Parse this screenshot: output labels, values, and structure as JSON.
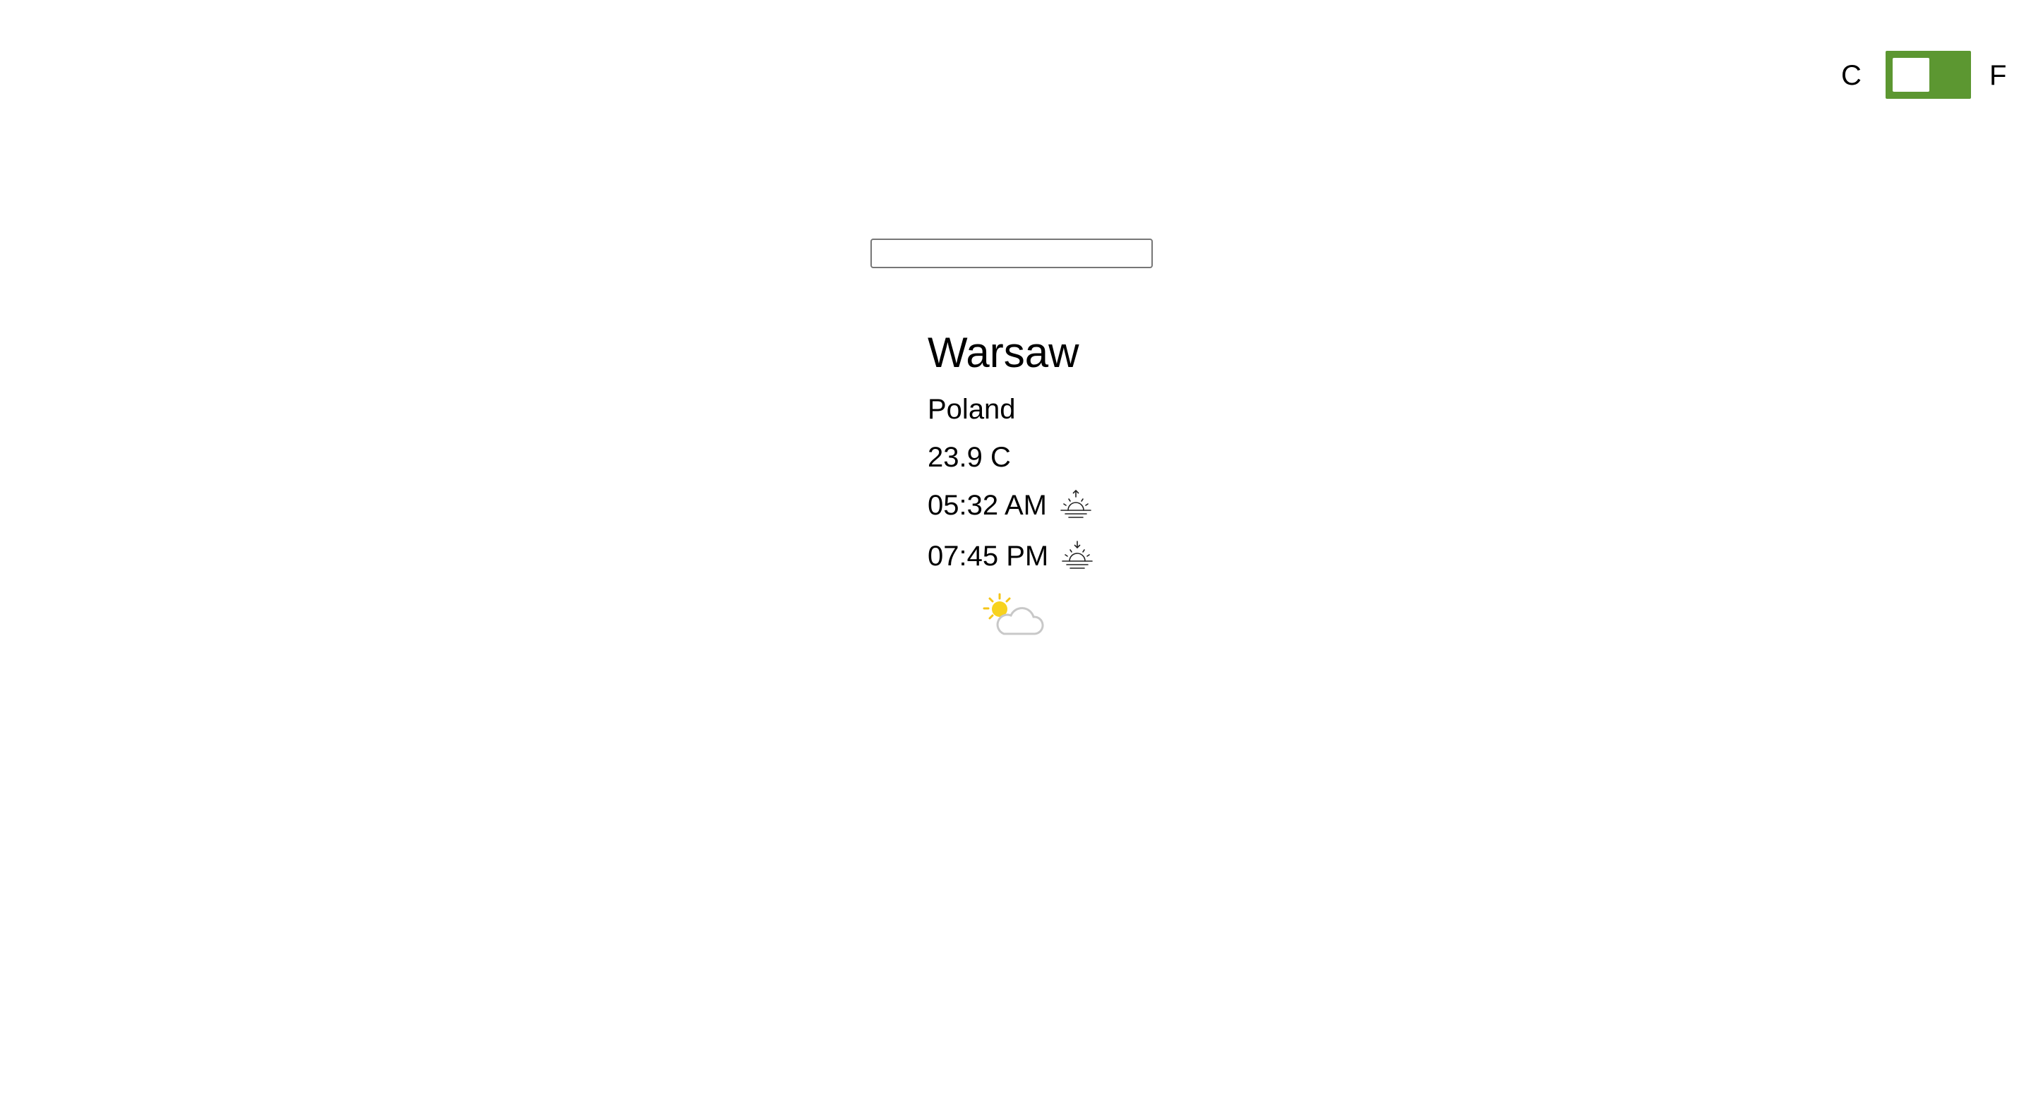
{
  "unit_toggle": {
    "left_label": "C",
    "right_label": "F"
  },
  "search": {
    "value": "",
    "placeholder": ""
  },
  "weather": {
    "city": "Warsaw",
    "country": "Poland",
    "temperature": "23.9 C",
    "sunrise": "05:32 AM",
    "sunset": "07:45 PM",
    "sunrise_icon": "sunrise-icon",
    "sunset_icon": "sunset-icon",
    "condition_icon": "partly-cloudy-icon"
  },
  "colors": {
    "toggle_background": "#5c9731",
    "toggle_knob": "#ffffff",
    "sun": "#f5c518",
    "cloud_outline": "#c8c8c8"
  }
}
